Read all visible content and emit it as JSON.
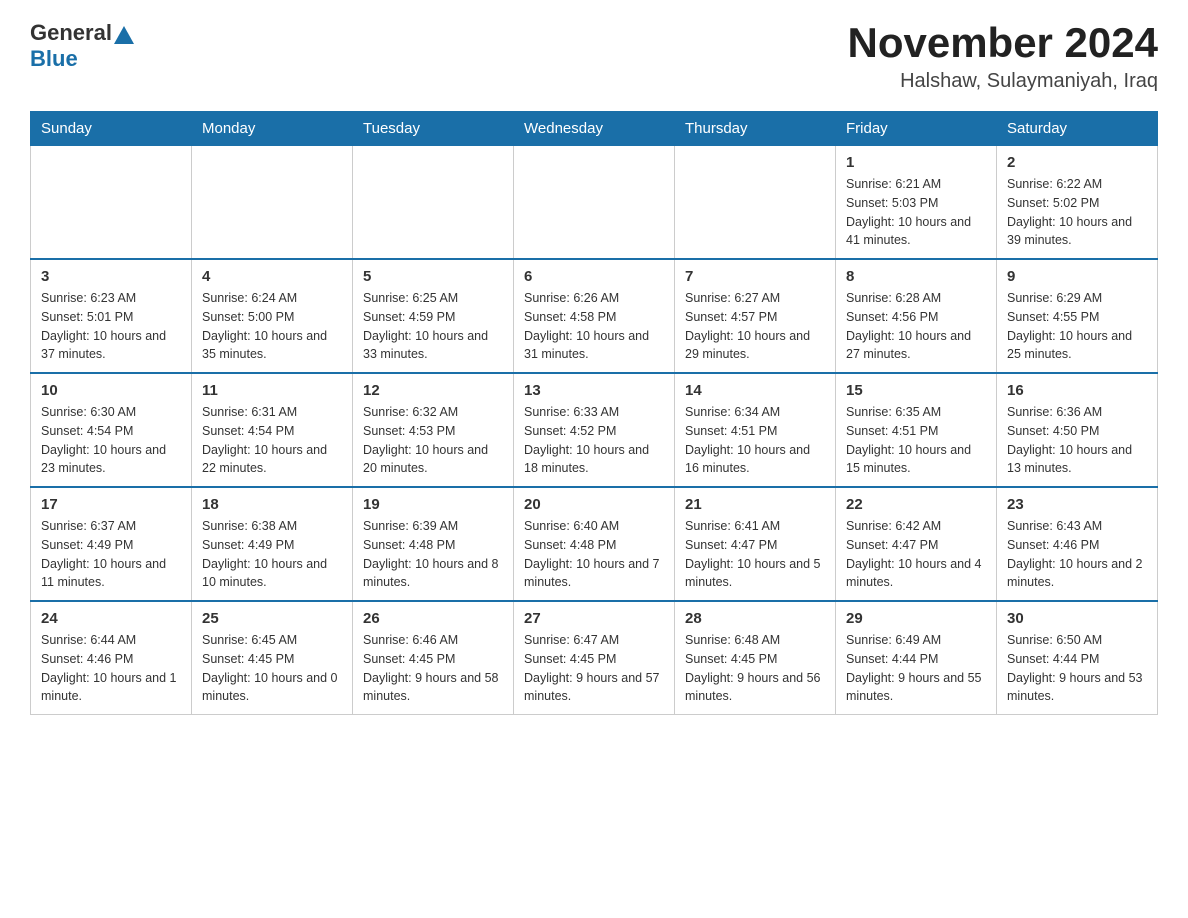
{
  "header": {
    "logo_general": "General",
    "logo_blue": "Blue",
    "title": "November 2024",
    "subtitle": "Halshaw, Sulaymaniyah, Iraq"
  },
  "weekdays": [
    "Sunday",
    "Monday",
    "Tuesday",
    "Wednesday",
    "Thursday",
    "Friday",
    "Saturday"
  ],
  "weeks": [
    [
      {
        "day": "",
        "info": ""
      },
      {
        "day": "",
        "info": ""
      },
      {
        "day": "",
        "info": ""
      },
      {
        "day": "",
        "info": ""
      },
      {
        "day": "",
        "info": ""
      },
      {
        "day": "1",
        "info": "Sunrise: 6:21 AM\nSunset: 5:03 PM\nDaylight: 10 hours and 41 minutes."
      },
      {
        "day": "2",
        "info": "Sunrise: 6:22 AM\nSunset: 5:02 PM\nDaylight: 10 hours and 39 minutes."
      }
    ],
    [
      {
        "day": "3",
        "info": "Sunrise: 6:23 AM\nSunset: 5:01 PM\nDaylight: 10 hours and 37 minutes."
      },
      {
        "day": "4",
        "info": "Sunrise: 6:24 AM\nSunset: 5:00 PM\nDaylight: 10 hours and 35 minutes."
      },
      {
        "day": "5",
        "info": "Sunrise: 6:25 AM\nSunset: 4:59 PM\nDaylight: 10 hours and 33 minutes."
      },
      {
        "day": "6",
        "info": "Sunrise: 6:26 AM\nSunset: 4:58 PM\nDaylight: 10 hours and 31 minutes."
      },
      {
        "day": "7",
        "info": "Sunrise: 6:27 AM\nSunset: 4:57 PM\nDaylight: 10 hours and 29 minutes."
      },
      {
        "day": "8",
        "info": "Sunrise: 6:28 AM\nSunset: 4:56 PM\nDaylight: 10 hours and 27 minutes."
      },
      {
        "day": "9",
        "info": "Sunrise: 6:29 AM\nSunset: 4:55 PM\nDaylight: 10 hours and 25 minutes."
      }
    ],
    [
      {
        "day": "10",
        "info": "Sunrise: 6:30 AM\nSunset: 4:54 PM\nDaylight: 10 hours and 23 minutes."
      },
      {
        "day": "11",
        "info": "Sunrise: 6:31 AM\nSunset: 4:54 PM\nDaylight: 10 hours and 22 minutes."
      },
      {
        "day": "12",
        "info": "Sunrise: 6:32 AM\nSunset: 4:53 PM\nDaylight: 10 hours and 20 minutes."
      },
      {
        "day": "13",
        "info": "Sunrise: 6:33 AM\nSunset: 4:52 PM\nDaylight: 10 hours and 18 minutes."
      },
      {
        "day": "14",
        "info": "Sunrise: 6:34 AM\nSunset: 4:51 PM\nDaylight: 10 hours and 16 minutes."
      },
      {
        "day": "15",
        "info": "Sunrise: 6:35 AM\nSunset: 4:51 PM\nDaylight: 10 hours and 15 minutes."
      },
      {
        "day": "16",
        "info": "Sunrise: 6:36 AM\nSunset: 4:50 PM\nDaylight: 10 hours and 13 minutes."
      }
    ],
    [
      {
        "day": "17",
        "info": "Sunrise: 6:37 AM\nSunset: 4:49 PM\nDaylight: 10 hours and 11 minutes."
      },
      {
        "day": "18",
        "info": "Sunrise: 6:38 AM\nSunset: 4:49 PM\nDaylight: 10 hours and 10 minutes."
      },
      {
        "day": "19",
        "info": "Sunrise: 6:39 AM\nSunset: 4:48 PM\nDaylight: 10 hours and 8 minutes."
      },
      {
        "day": "20",
        "info": "Sunrise: 6:40 AM\nSunset: 4:48 PM\nDaylight: 10 hours and 7 minutes."
      },
      {
        "day": "21",
        "info": "Sunrise: 6:41 AM\nSunset: 4:47 PM\nDaylight: 10 hours and 5 minutes."
      },
      {
        "day": "22",
        "info": "Sunrise: 6:42 AM\nSunset: 4:47 PM\nDaylight: 10 hours and 4 minutes."
      },
      {
        "day": "23",
        "info": "Sunrise: 6:43 AM\nSunset: 4:46 PM\nDaylight: 10 hours and 2 minutes."
      }
    ],
    [
      {
        "day": "24",
        "info": "Sunrise: 6:44 AM\nSunset: 4:46 PM\nDaylight: 10 hours and 1 minute."
      },
      {
        "day": "25",
        "info": "Sunrise: 6:45 AM\nSunset: 4:45 PM\nDaylight: 10 hours and 0 minutes."
      },
      {
        "day": "26",
        "info": "Sunrise: 6:46 AM\nSunset: 4:45 PM\nDaylight: 9 hours and 58 minutes."
      },
      {
        "day": "27",
        "info": "Sunrise: 6:47 AM\nSunset: 4:45 PM\nDaylight: 9 hours and 57 minutes."
      },
      {
        "day": "28",
        "info": "Sunrise: 6:48 AM\nSunset: 4:45 PM\nDaylight: 9 hours and 56 minutes."
      },
      {
        "day": "29",
        "info": "Sunrise: 6:49 AM\nSunset: 4:44 PM\nDaylight: 9 hours and 55 minutes."
      },
      {
        "day": "30",
        "info": "Sunrise: 6:50 AM\nSunset: 4:44 PM\nDaylight: 9 hours and 53 minutes."
      }
    ]
  ]
}
